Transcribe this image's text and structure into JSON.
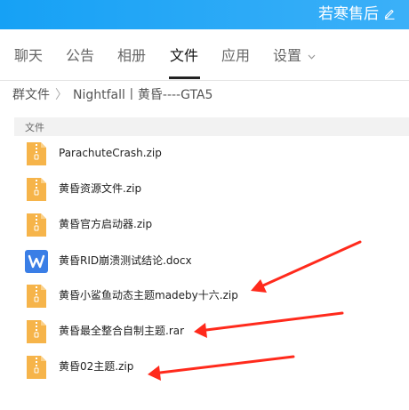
{
  "window": {
    "group_name": "若寒售后"
  },
  "tabs": [
    {
      "label": "聊天"
    },
    {
      "label": "公告"
    },
    {
      "label": "相册"
    },
    {
      "label": "文件",
      "active": true
    },
    {
      "label": "应用"
    },
    {
      "label": "设置"
    }
  ],
  "breadcrumb": {
    "root": "群文件",
    "sep": "〉",
    "current": "Nightfall丨黄昏----GTA5"
  },
  "file_list": {
    "header": "文件",
    "files": [
      {
        "name": "ParachuteCrash.zip",
        "icon": "zip-file-icon"
      },
      {
        "name": "黄昏资源文件.zip",
        "icon": "zip-file-icon"
      },
      {
        "name": "黄昏官方启动器.zip",
        "icon": "zip-file-icon"
      },
      {
        "name": "黄昏RID崩溃测试结论.docx",
        "icon": "word-doc-icon"
      },
      {
        "name": "黄昏小鲨鱼动态主题madeby十六.zip",
        "icon": "zip-file-icon"
      },
      {
        "name": "黄昏最全整合自制主题.rar",
        "icon": "zip-file-icon"
      },
      {
        "name": "黄昏02主题.zip",
        "icon": "zip-file-icon"
      }
    ]
  },
  "colors": {
    "accent": "#16a1f5",
    "folder": "#f6b44a",
    "word": "#3a7ee6",
    "annotation": "#ff2a1c"
  }
}
